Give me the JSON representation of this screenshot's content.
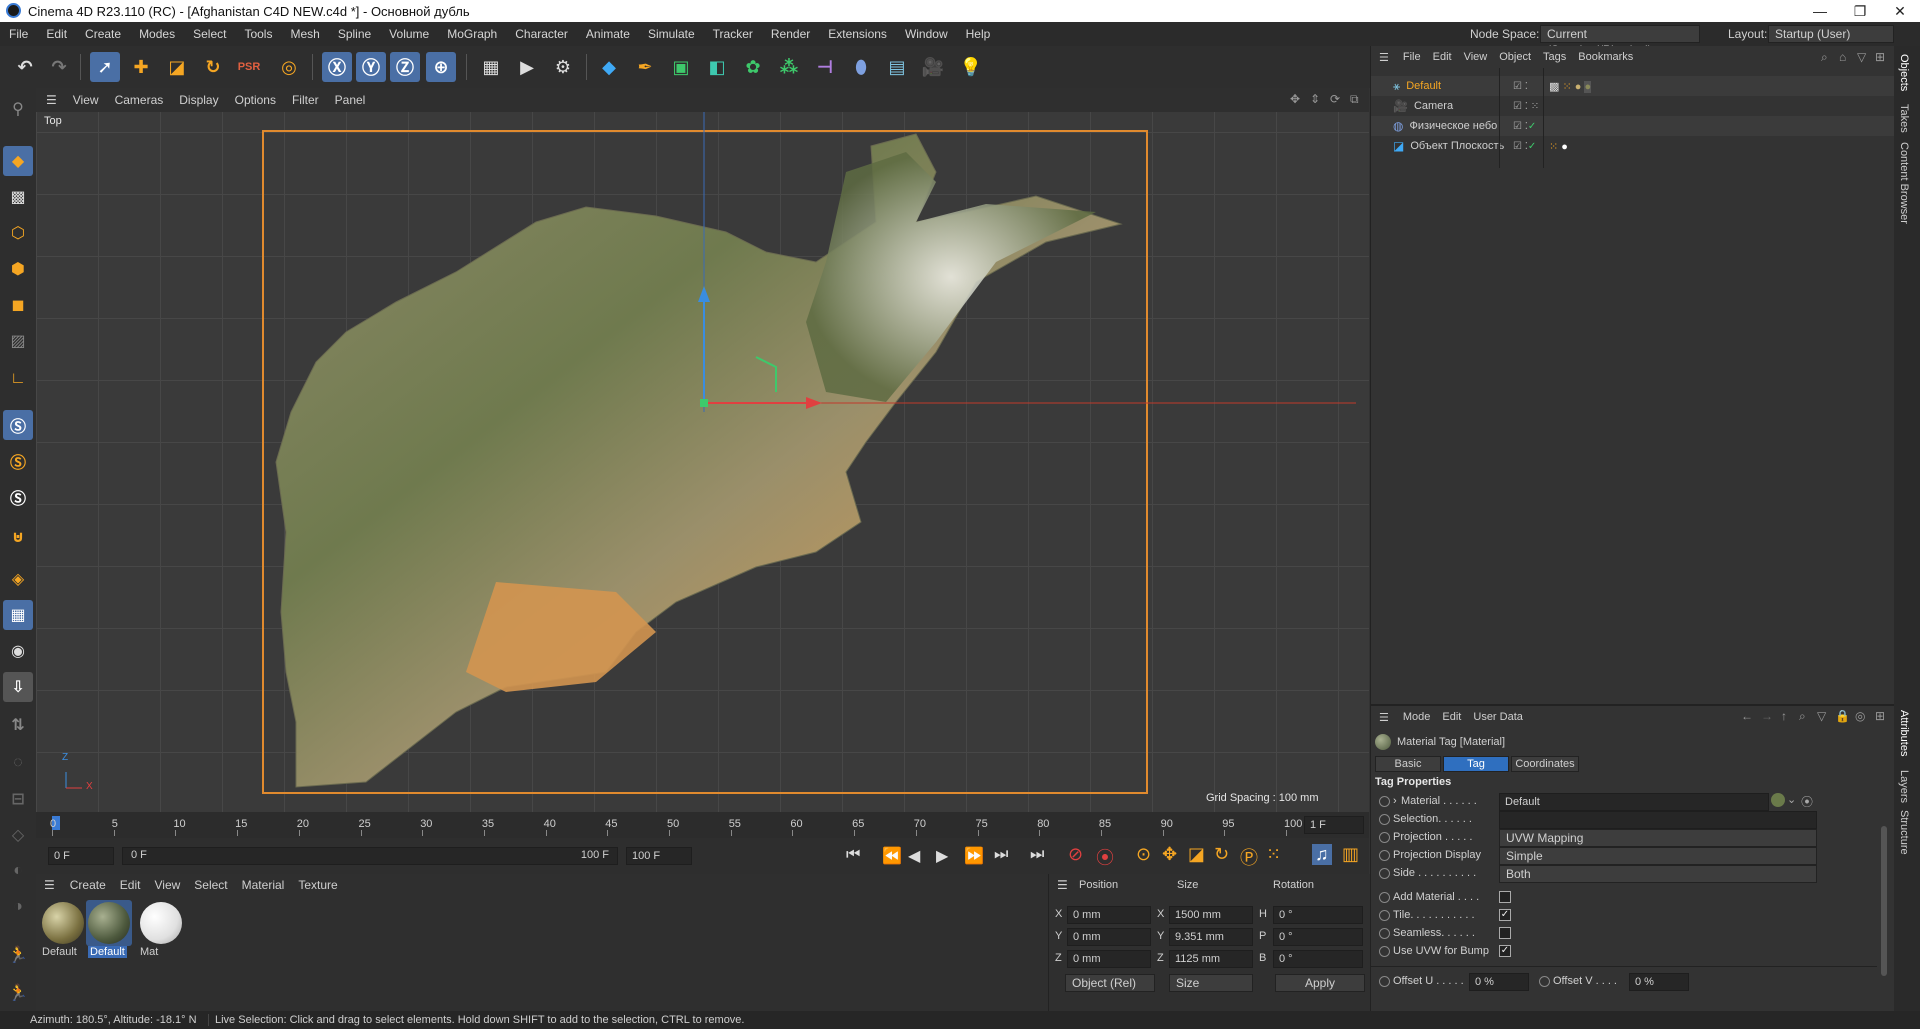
{
  "window": {
    "title": "Cinema 4D R23.110 (RC) - [Afghanistan C4D NEW.c4d *] - Основной дубль",
    "minimize": "—",
    "maximize": "❐",
    "close": "✕"
  },
  "menubar": {
    "items": [
      "File",
      "Edit",
      "Create",
      "Modes",
      "Select",
      "Tools",
      "Mesh",
      "Spline",
      "Volume",
      "MoGraph",
      "Character",
      "Animate",
      "Simulate",
      "Tracker",
      "Render",
      "Extensions",
      "Window",
      "Help"
    ],
    "node_space_label": "Node Space:",
    "node_space_value": "Current (Standard/Physical)",
    "layout_label": "Layout:",
    "layout_value": "Startup (User)"
  },
  "viewport": {
    "menu": [
      "View",
      "Cameras",
      "Display",
      "Options",
      "Filter",
      "Panel"
    ],
    "view_name": "Top",
    "grid_spacing": "Grid Spacing : 100 mm",
    "axis_z": "Z",
    "axis_x": "X"
  },
  "timeline": {
    "ticks": [
      "0",
      "5",
      "10",
      "15",
      "20",
      "25",
      "30",
      "35",
      "40",
      "45",
      "50",
      "55",
      "60",
      "65",
      "70",
      "75",
      "80",
      "85",
      "90",
      "95",
      "100"
    ],
    "current_frame_field": "1 F",
    "start_field": "0 F",
    "range_start": "0 F",
    "range_end": "100 F",
    "end_field": "100 F"
  },
  "materials": {
    "menu": [
      "Create",
      "Edit",
      "View",
      "Select",
      "Material",
      "Texture"
    ],
    "items": [
      {
        "label": "Default",
        "selected": false,
        "color": "#8a8a5a"
      },
      {
        "label": "Default",
        "selected": true,
        "color": "#4e5a3e"
      },
      {
        "label": "Mat",
        "selected": false,
        "color": "#ffffff"
      }
    ]
  },
  "coordinates": {
    "headers": [
      "Position",
      "Size",
      "Rotation"
    ],
    "rows": [
      {
        "pos_axis": "X",
        "pos": "0 mm",
        "size_axis": "X",
        "size": "1500 mm",
        "rot_axis": "H",
        "rot": "0 °"
      },
      {
        "pos_axis": "Y",
        "pos": "0 mm",
        "size_axis": "Y",
        "size": "9.351 mm",
        "rot_axis": "P",
        "rot": "0 °"
      },
      {
        "pos_axis": "Z",
        "pos": "0 mm",
        "size_axis": "Z",
        "size": "1125 mm",
        "rot_axis": "B",
        "rot": "0 °"
      }
    ],
    "mode_select": "Object (Rel)",
    "size_select": "Size",
    "apply": "Apply"
  },
  "objects": {
    "menu": [
      "File",
      "Edit",
      "View",
      "Object",
      "Tags",
      "Bookmarks"
    ],
    "rows": [
      {
        "name": "Default",
        "highlight": true
      },
      {
        "name": "Camera",
        "highlight": false
      },
      {
        "name": "Физическое небо",
        "highlight": false
      },
      {
        "name": "Объект Плоскость",
        "highlight": false
      }
    ]
  },
  "attributes": {
    "menu": [
      "Mode",
      "Edit",
      "User Data"
    ],
    "title": "Material Tag [Material]",
    "tabs": [
      "Basic",
      "Tag",
      "Coordinates"
    ],
    "active_tab": "Tag",
    "section": "Tag Properties",
    "material_label": "Material . . . . . .",
    "material_value": "Default",
    "selection_label": "Selection. . . . . .",
    "projection_label": "Projection . . . . .",
    "projection_value": "UVW Mapping",
    "projection_display_label": "Projection Display",
    "projection_display_value": "Simple",
    "side_label": "Side . . . . . . . . . .",
    "side_value": "Both",
    "add_material_label": "Add Material . . . .",
    "tile_label": "Tile. . . . . . . . . . .",
    "seamless_label": "Seamless. . . . . .",
    "use_uvw_label": "Use UVW for Bump",
    "offset_u_label": "Offset U . . . . .",
    "offset_u_value": "0 %",
    "offset_v_label": "Offset V . . . .",
    "offset_v_value": "0 %",
    "tile_checked": true,
    "use_uvw_checked": true
  },
  "right_strip": {
    "tabs": [
      "Objects",
      "Takes",
      "Content Browser",
      "Attributes",
      "Layers",
      "Structure"
    ]
  },
  "statusbar": {
    "azimuth": "Azimuth: 180.5°, Altitude: -18.1°  N",
    "hint": "Live Selection: Click and drag to select elements. Hold down SHIFT to add to the selection, CTRL to remove."
  },
  "colors": {
    "accent": "#4a6fa5",
    "frame_orange": "#e08a2e",
    "active_tab": "#2f6fbf",
    "highlight_name": "#f5a623"
  }
}
